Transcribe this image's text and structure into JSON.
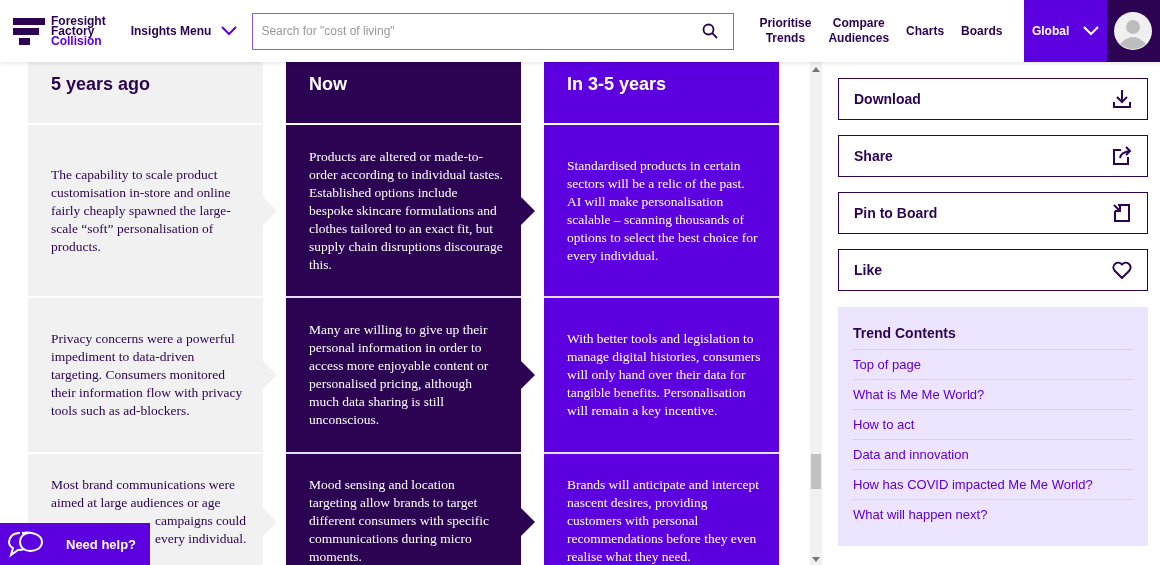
{
  "header": {
    "logo_lines": [
      "Foresight",
      "Factory",
      "Collision"
    ],
    "menu": "Insights Menu",
    "search": {
      "placeholder": "Search for \"cost of living\""
    },
    "nav": [
      "Prioritise Trends",
      "Compare Audiences",
      "Charts",
      "Boards"
    ],
    "region": "Global"
  },
  "timeline": {
    "columns": [
      {
        "title": "5 years ago",
        "kind": "past"
      },
      {
        "title": "Now",
        "kind": "now"
      },
      {
        "title": "In 3-5 years",
        "kind": "future"
      }
    ],
    "rows": [
      [
        {
          "text": "The capability to scale product customisation in-store and online fairly cheaply spawned the large-scale “soft” personalisation of products."
        },
        {
          "text": "Products are altered or made-to-order according to individual tastes. Established options include bespoke skincare formulations and clothes tailored to an exact fit, but supply chain disruptions discourage this."
        },
        {
          "text": "Standardised products in certain sectors will be a relic of the past. AI will make personalisation scalable – scanning thousands of options to select the best choice for every individual."
        }
      ],
      [
        {
          "text": "Privacy concerns were a powerful impediment to data-driven targeting. Consumers monitored their information flow with privacy tools such as ad-blockers."
        },
        {
          "text": "Many are willing to give up their personal information in order to access more enjoyable content or personalised pricing, although much data sharing is still unconscious."
        },
        {
          "text": "With better tools and legislation to manage digital histories, consumers will only hand over their data for tangible benefits. Personalisation will remain a key incentive."
        }
      ],
      [
        {
          "text": "Most brand communications were aimed at large audiences or age",
          "fragments": [
            "campaigns could",
            "every individual."
          ]
        },
        {
          "text": "Mood sensing and location targeting allow brands to target different consumers with specific communications during micro moments."
        },
        {
          "text": "Brands will anticipate and intercept nascent desires, providing customers with personal recommendations before they even realise what they need."
        }
      ]
    ]
  },
  "actions": [
    {
      "label": "Download",
      "kind": "download"
    },
    {
      "label": "Share",
      "kind": "share"
    },
    {
      "label": "Pin to Board",
      "kind": "pin"
    },
    {
      "label": "Like",
      "kind": "like"
    }
  ],
  "contents": {
    "title": "Trend Contents",
    "items": [
      "Top of page",
      "What is Me Me World?",
      "How to act",
      "Data and innovation",
      "How has COVID impacted Me Me World?",
      "What will happen next?"
    ]
  },
  "help": {
    "label": "Need help?"
  }
}
